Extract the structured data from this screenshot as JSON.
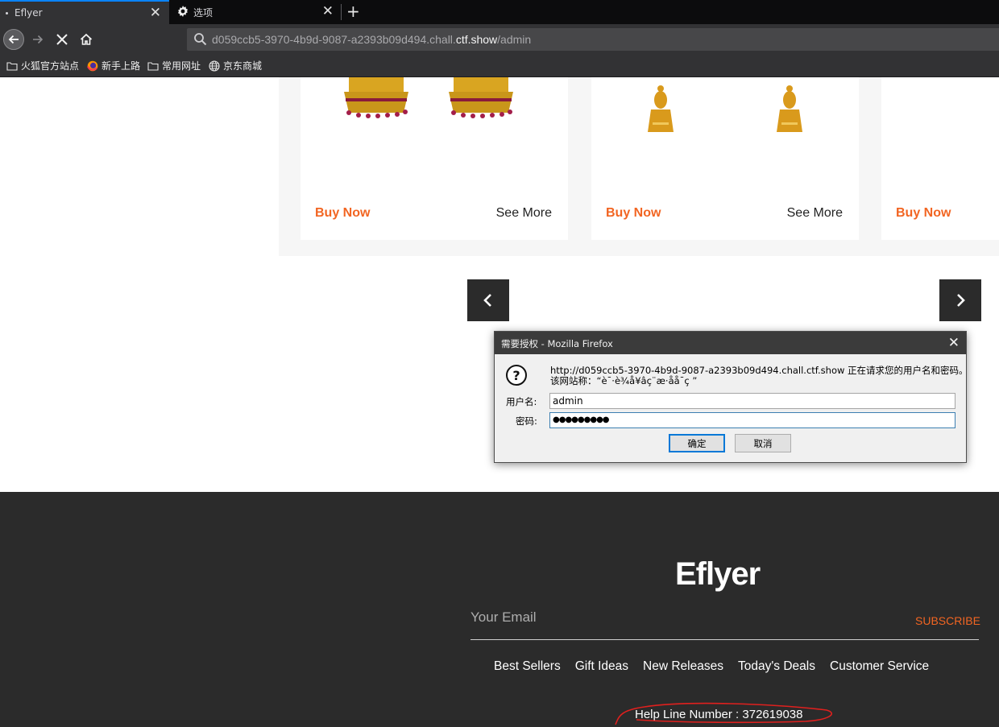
{
  "browser": {
    "tabs": [
      {
        "title": "Eflyer",
        "active": true
      },
      {
        "title": "选项",
        "active": false
      }
    ],
    "url_prefix": "d059ccb5-3970-4b9d-9087-a2393b09d494.chall.",
    "url_domain": "ctf.show",
    "url_path": "/admin",
    "bookmarks": [
      "火狐官方站点",
      "新手上路",
      "常用网址",
      "京东商城"
    ]
  },
  "products": [
    {
      "buy": "Buy Now",
      "more": "See More"
    },
    {
      "buy": "Buy Now",
      "more": "See More"
    },
    {
      "buy": "Buy Now"
    }
  ],
  "footer": {
    "logo": "Eflyer",
    "email_placeholder": "Your Email",
    "subscribe": "SUBSCRIBE",
    "links": [
      "Best Sellers",
      "Gift Ideas",
      "New Releases",
      "Today's Deals",
      "Customer Service"
    ],
    "helpline": "Help Line Number : 372619038"
  },
  "dialog": {
    "title": "需要授权 - Mozilla Firefox",
    "message_line1": "http://d059ccb5-3970-4b9d-9087-a2393b09d494.chall.ctf.show 正在请求您的用户名和密码。",
    "message_line2": "该网站称：“è¯·è¾å¥âç¨æ·åå¯ç ”",
    "username_label": "用户名:",
    "password_label": "密码:",
    "username_value": "admin",
    "password_value": "●●●●●●●●●",
    "ok_label": "确定",
    "cancel_label": "取消"
  }
}
